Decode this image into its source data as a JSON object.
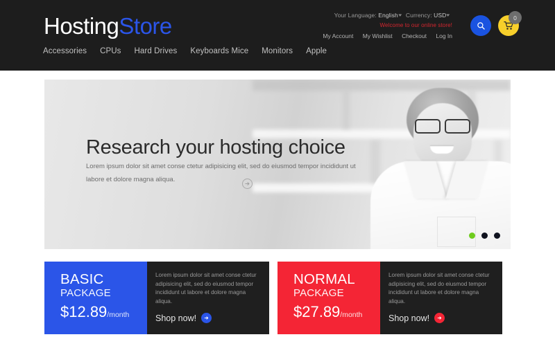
{
  "header": {
    "logo": {
      "part1": "Hosting",
      "part2": "Store"
    },
    "utility": {
      "language_label": "Your Language:",
      "language_value": "English",
      "currency_label": "Currency:",
      "currency_value": "USD",
      "welcome": "Welcome to our online store!",
      "links": [
        "My Account",
        "My Wishlist",
        "Checkout",
        "Log In"
      ]
    },
    "search_icon": "search-icon",
    "cart_icon": "cart-icon",
    "cart_count": "0",
    "nav": [
      "Accessories",
      "CPUs",
      "Hard Drives",
      "Keyboards Mice",
      "Monitors",
      "Apple"
    ]
  },
  "hero": {
    "title": "Research your hosting choice",
    "description": "Lorem ipsum dolor sit amet conse ctetur adipisicing elit, sed do eiusmod tempor incididunt ut labore et dolore magna aliqua.",
    "arrow_icon": "arrow-right-icon",
    "dots": [
      "active",
      "idle",
      "idle"
    ]
  },
  "packages": [
    {
      "name": "BASIC",
      "subtitle": "PACKAGE",
      "price": "$12.89",
      "period": "/month",
      "description": "Lorem ipsum dolor sit amet conse ctetur adipisicing elit, sed do eiusmod tempor incididunt ut labore et dolore magna aliqua.",
      "cta": "Shop now!",
      "accent": "#2b55e8"
    },
    {
      "name": "NORMAL",
      "subtitle": "PACKAGE",
      "price": "$27.89",
      "period": "/month",
      "description": "Lorem ipsum dolor sit amet conse ctetur adipisicing elit, sed do eiusmod tempor incididunt ut labore et dolore magna aliqua.",
      "cta": "Shop now!",
      "accent": "#f42535"
    }
  ],
  "colors": {
    "header_bg": "#1d1d1d",
    "blue": "#2b55e8",
    "red": "#f42535",
    "yellow": "#f7cf2b",
    "green": "#6fcc1e",
    "panel_dark": "#1f1f1f"
  }
}
